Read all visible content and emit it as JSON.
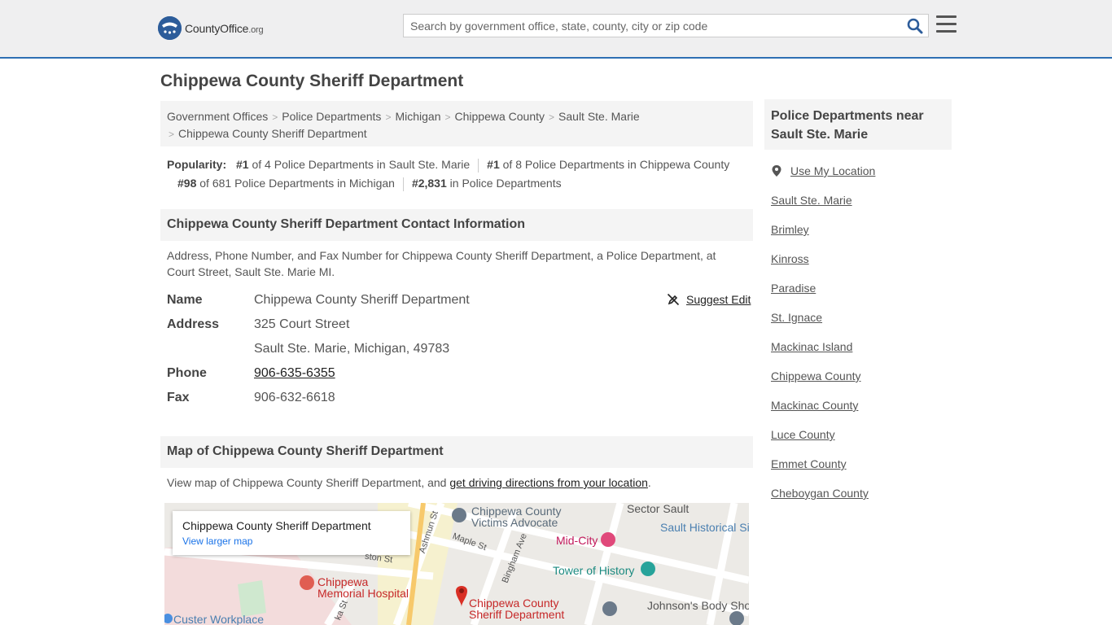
{
  "header": {
    "logo_text": "CountyOffice",
    "logo_tld": ".org",
    "search_placeholder": "Search by government office, state, county, city or zip code"
  },
  "page": {
    "title": "Chippewa County Sheriff Department"
  },
  "breadcrumb": [
    "Government Offices",
    "Police Departments",
    "Michigan",
    "Chippewa County",
    "Sault Ste. Marie",
    "Chippewa County Sheriff Department"
  ],
  "popularity": {
    "label": "Popularity:",
    "items": [
      {
        "rank": "#1",
        "text": "of 4 Police Departments in Sault Ste. Marie"
      },
      {
        "rank": "#1",
        "text": "of 8 Police Departments in Chippewa County"
      },
      {
        "rank": "#98",
        "text": "of 681 Police Departments in Michigan"
      },
      {
        "rank": "#2,831",
        "text": "in Police Departments"
      }
    ]
  },
  "contact": {
    "heading": "Chippewa County Sheriff Department Contact Information",
    "description": "Address, Phone Number, and Fax Number for Chippewa County Sheriff Department, a Police Department, at Court Street, Sault Ste. Marie MI.",
    "suggest_edit": "Suggest Edit",
    "name_label": "Name",
    "name": "Chippewa County Sheriff Department",
    "address_label": "Address",
    "address_line1": "325 Court Street",
    "address_line2": "Sault Ste. Marie, Michigan, 49783",
    "phone_label": "Phone",
    "phone": "906-635-6355",
    "fax_label": "Fax",
    "fax": "906-632-6618"
  },
  "map": {
    "heading": "Map of Chippewa County Sheriff Department",
    "desc_prefix": "View map of Chippewa County Sheriff Department, and ",
    "desc_link": "get driving directions from your location",
    "desc_suffix": ".",
    "card_title": "Chippewa County Sheriff Department",
    "card_link": "View larger map",
    "places": {
      "victims1": "Chippewa County",
      "victims2": "Victims Advocate",
      "sector": "Sector Sault",
      "historical": "Sault Historical Si",
      "midcity": "Mid-City",
      "tower": "Tower of History",
      "hospital1": "Chippewa",
      "hospital2": "Memorial Hospital",
      "sheriff1": "Chippewa County",
      "sheriff2": "Sheriff Department",
      "johnsons": "Johnson's Body Sho",
      "custer": "Custer Workplace",
      "maple": "Maple St",
      "bingham": "Bingham Ave",
      "ashmun": "Ashmun St",
      "ston": "ston St",
      "ka": "ka St"
    }
  },
  "sidebar": {
    "heading": "Police Departments near Sault Ste. Marie",
    "use_location": "Use My Location",
    "items": [
      "Sault Ste. Marie",
      "Brimley",
      "Kinross",
      "Paradise",
      "St. Ignace",
      "Mackinac Island",
      "Chippewa County",
      "Mackinac County",
      "Luce County",
      "Emmet County",
      "Cheboygan County"
    ]
  },
  "colors": {
    "brand_blue": "#2c5c9a",
    "header_bg": "#efeff0",
    "panel_bg": "#f4f4f4",
    "map_pin_red": "#d93025",
    "map_link_blue": "#1a73e8"
  }
}
